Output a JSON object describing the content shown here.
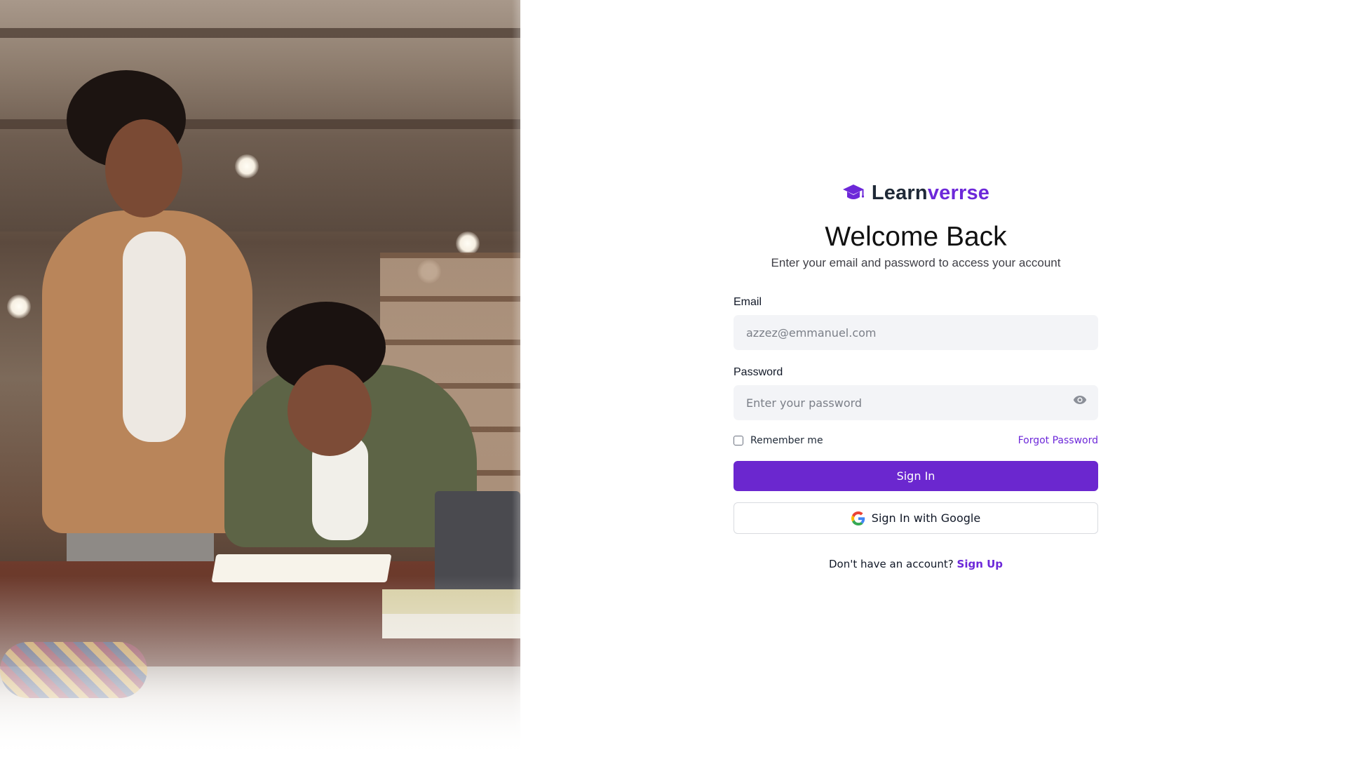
{
  "brand": {
    "name_part1": "Learn",
    "name_part2": "verrse",
    "icon": "graduation-cap-icon",
    "accent_color": "#6d28d9"
  },
  "header": {
    "title": "Welcome Back",
    "subtitle": "Enter your email and password to access your account"
  },
  "form": {
    "email_label": "Email",
    "email_placeholder": "azzez@emmanuel.com",
    "password_label": "Password",
    "password_placeholder": "Enter your password",
    "remember_label": "Remember me",
    "remember_checked": false,
    "forgot_label": "Forgot Password",
    "sign_in_label": "Sign In",
    "google_label": "Sign In with Google"
  },
  "footer": {
    "prompt": "Don't have an account?",
    "signup_label": "Sign Up"
  },
  "colors": {
    "primary": "#6b27cf",
    "input_bg": "#f3f4f7"
  }
}
